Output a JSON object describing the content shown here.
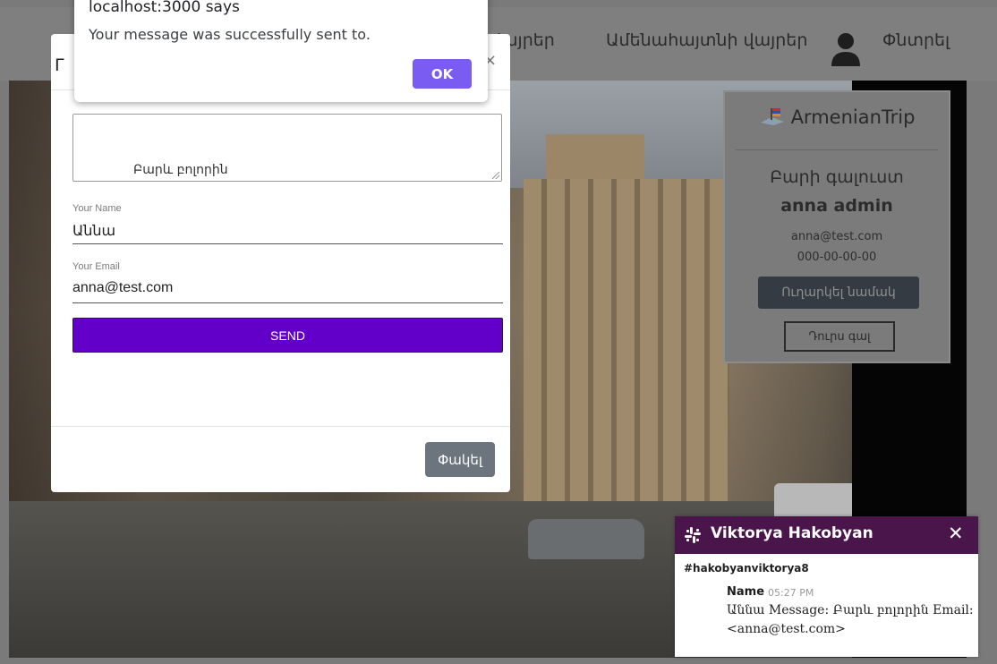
{
  "navbar": {
    "link_places": "վայրեր",
    "link_popular": "Ամենահայտնի վայրեր",
    "link_search": "Փնտրել",
    "user_icon": "user-icon"
  },
  "profile_card": {
    "brand": "ArmenianTrip",
    "brand_icon": "map-flag-icon",
    "welcome": "Բարի գալուստ",
    "user_name": "anna admin",
    "email": "anna@test.com",
    "phone": "000-00-00-00",
    "send_letter_label": "Ուղարկել նամակ",
    "logout_label": "Դուրս գալ"
  },
  "modal": {
    "title_glimpse": "Г",
    "close_glyph": "×",
    "message_value": "Բարև բոլորին",
    "name_label": "Your Name",
    "name_value": "Աննա",
    "email_label": "Your Email",
    "email_value": "anna@test.com",
    "send_label": "SEND",
    "close_label": "Փակել"
  },
  "alert": {
    "title": "localhost:3000 says",
    "message": "Your message was successfully sent to.",
    "ok_label": "OK"
  },
  "notification": {
    "title": "Viktorya Hakobyan",
    "close_glyph": "✕",
    "channel": "#hakobyanviktorya8",
    "sender": "Name",
    "time": "05:27 PM",
    "text": "Աննա Message: Բարև բոլորին Email: <anna@test.com>",
    "logo_icon": "slack-logo-icon"
  },
  "colors": {
    "send_button": "#6200c9",
    "ok_button": "#7b5cf2",
    "notif_header": "#4a154b",
    "close_button": "#6c757d"
  }
}
